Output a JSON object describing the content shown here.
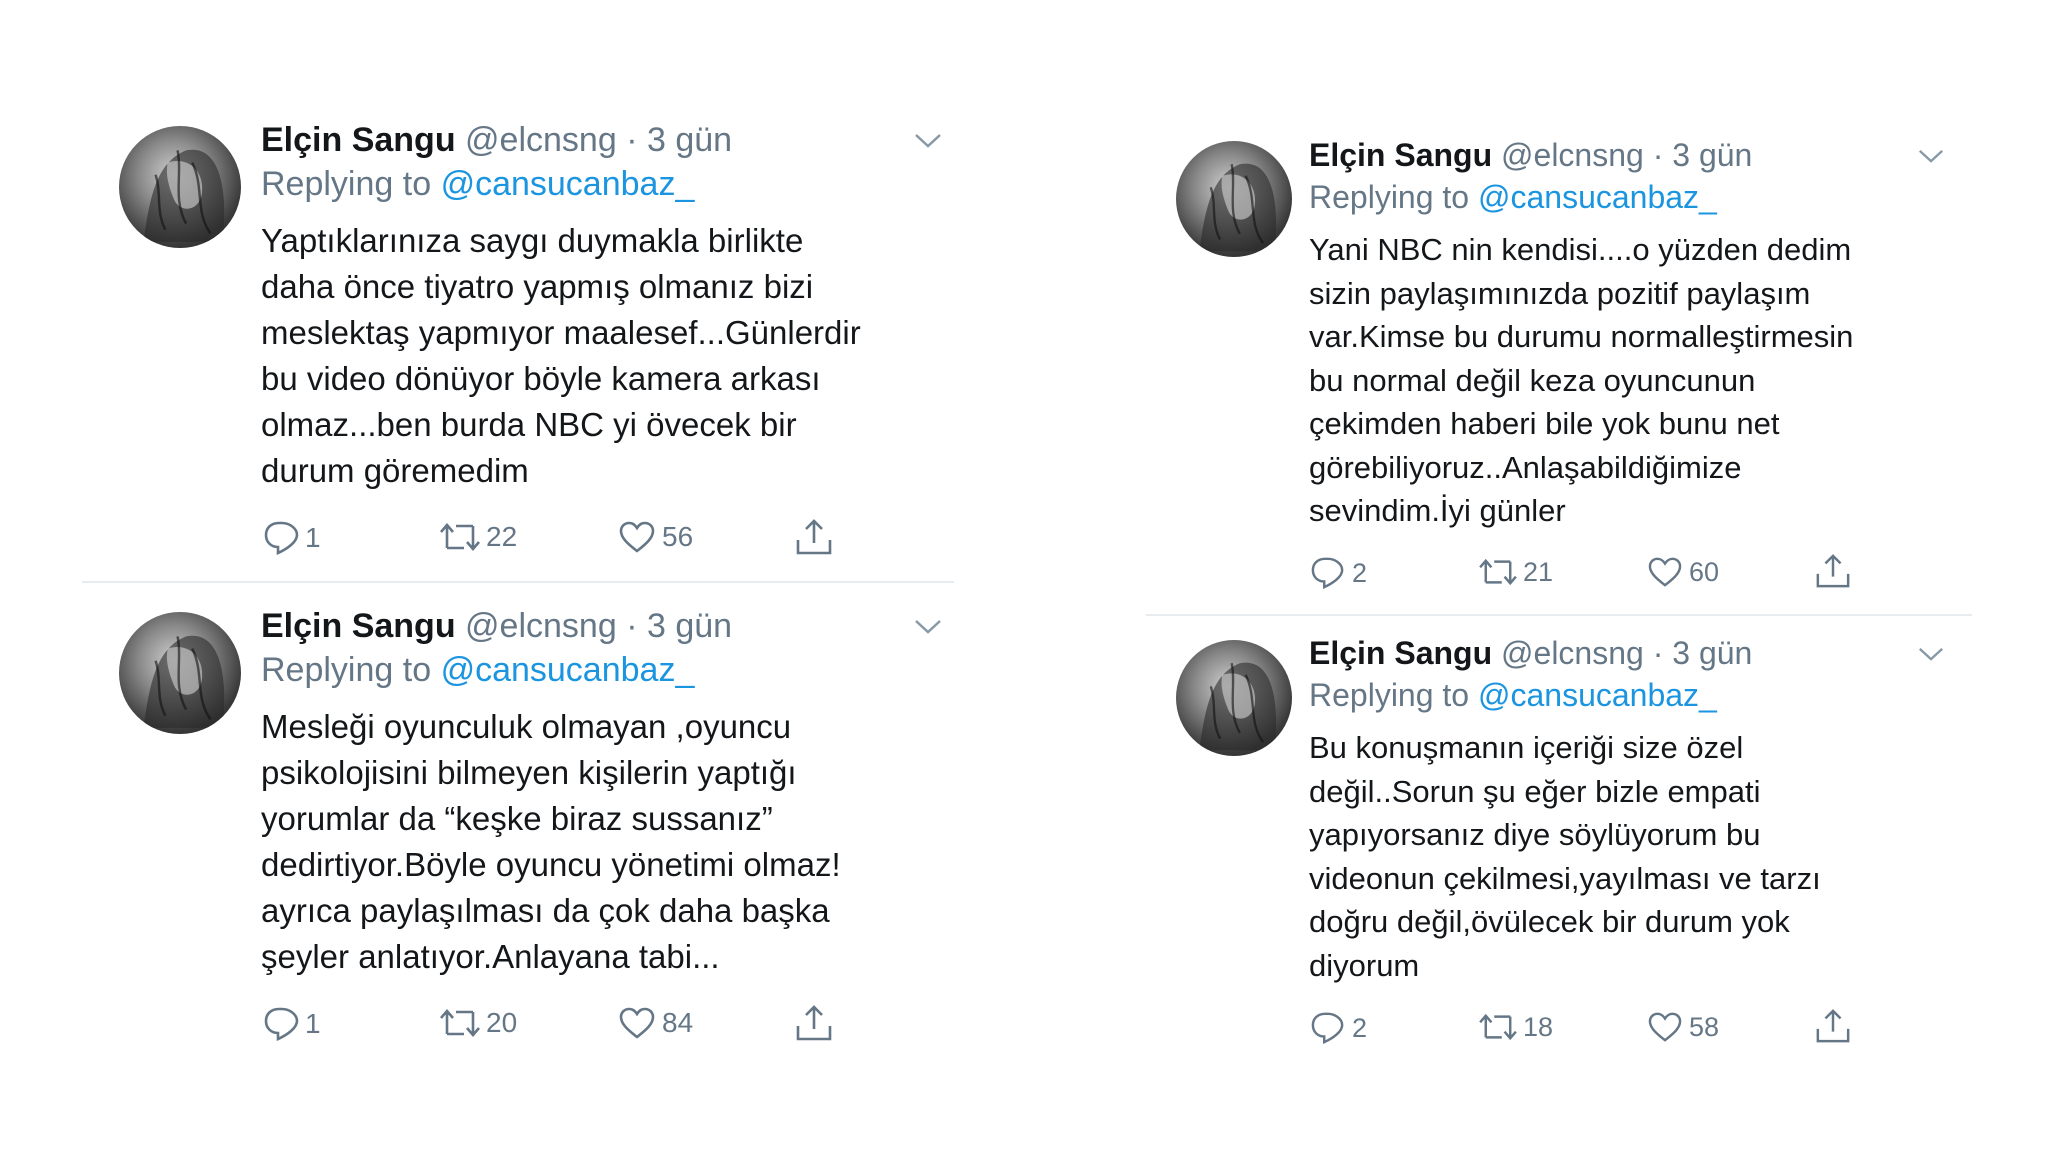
{
  "tweets": [
    {
      "author_name": "Elçin Sangu",
      "handle": "@elcnsng",
      "separator": "·",
      "time": "3 gün",
      "replying_prefix": "Replying to",
      "replying_to": "@cansucanbaz_",
      "lines": [
        "Yaptıklarınıza saygı duymakla birlikte",
        "daha önce tiyatro yapmış olmanız bizi",
        "meslektaş yapmıyor maalesef...Günlerdir",
        "bu video dönüyor böyle kamera arkası",
        "olmaz...ben burda NBC yi övecek bir",
        "durum göremedim"
      ],
      "replies": "1",
      "retweets": "22",
      "likes": "56"
    },
    {
      "author_name": "Elçin Sangu",
      "handle": "@elcnsng",
      "separator": "·",
      "time": "3 gün",
      "replying_prefix": "Replying to",
      "replying_to": "@cansucanbaz_",
      "lines": [
        "Mesleği oyunculuk olmayan ,oyuncu",
        "psikolojisini bilmeyen kişilerin yaptığı",
        "yorumlar da “keşke biraz sussanız”",
        "dedirtiyor.Böyle oyuncu yönetimi olmaz!",
        "ayrıca paylaşılması da çok daha başka",
        "şeyler anlatıyor.Anlayana tabi..."
      ],
      "replies": "1",
      "retweets": "20",
      "likes": "84"
    },
    {
      "author_name": "Elçin Sangu",
      "handle": "@elcnsng",
      "separator": "·",
      "time": "3 gün",
      "replying_prefix": "Replying to",
      "replying_to": "@cansucanbaz_",
      "lines": [
        "Yani NBC nin kendisi....o yüzden dedim",
        "sizin paylaşımınızda pozitif paylaşım",
        "var.Kimse bu durumu normalleştirmesin",
        "bu normal değil keza oyuncunun",
        "çekimden haberi bile yok bunu net",
        "görebiliyoruz..Anlaşabildiğimize",
        "sevindim.İyi günler"
      ],
      "replies": "2",
      "retweets": "21",
      "likes": "60"
    },
    {
      "author_name": "Elçin Sangu",
      "handle": "@elcnsng",
      "separator": "·",
      "time": "3 gün",
      "replying_prefix": "Replying to",
      "replying_to": "@cansucanbaz_",
      "lines": [
        "Bu konuşmanın içeriği size özel",
        "değil..Sorun şu eğer bizle empati",
        "yapıyorsanız diye söylüyorum bu",
        "videonun çekilmesi,yayılması ve tarzı",
        "doğru değil,övülecek bir durum yok",
        "diyorum"
      ],
      "replies": "2",
      "retweets": "18",
      "likes": "58"
    }
  ],
  "colors": {
    "text": "#14171a",
    "secondary": "#657786",
    "link": "#1b95e0",
    "divider": "#e6ecf0"
  },
  "icons": {
    "reply": "reply-icon",
    "retweet": "retweet-icon",
    "like": "heart-icon",
    "share": "share-icon",
    "caret": "chevron-down-icon"
  }
}
